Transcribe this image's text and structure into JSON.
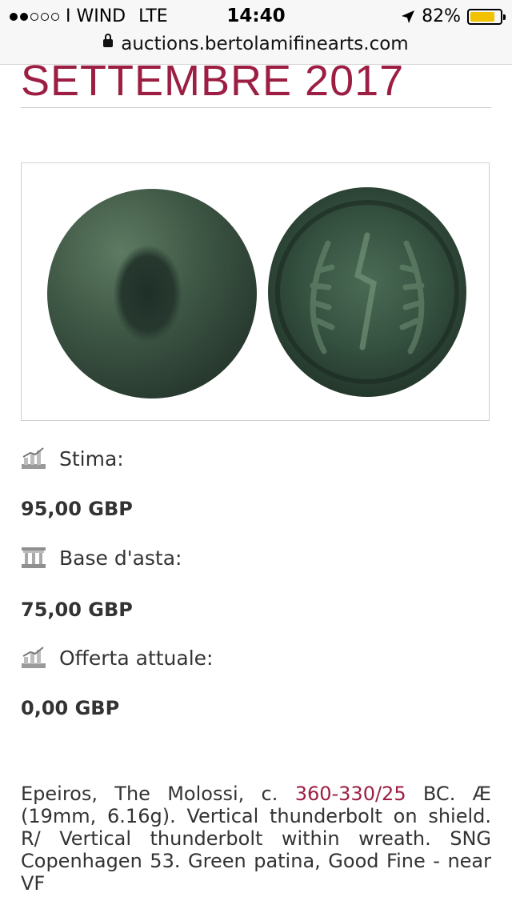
{
  "status_bar": {
    "signal_dots_filled": 2,
    "signal_dots_total": 5,
    "carrier": "I WIND",
    "network": "LTE",
    "time": "14:40",
    "battery_percent": "82%",
    "battery_level": 0.82,
    "battery_color": "#f2c200",
    "url": "auctions.bertolamifinearts.com"
  },
  "page": {
    "title": "SETTEMBRE 2017",
    "title_color": "#9c1f43"
  },
  "lot": {
    "image_alt": "",
    "estimate_label": "Stima:",
    "estimate_value": "95,00 GBP",
    "estimate_icon": "chart-icon",
    "start_label": "Base d'asta:",
    "start_value": "75,00 GBP",
    "start_icon": "bank-icon",
    "current_label": "Offerta attuale:",
    "current_value": "0,00 GBP",
    "current_icon": "chart-icon",
    "description_pre": "Epeiros, The Molossi, c. ",
    "description_link": "360-330/25",
    "description_post": " BC. Æ (19mm, 6.16g). Vertical thunderbolt on shield. R/ Vertical thunderbolt within wreath. SNG Copenhagen 53. Green patina, Good Fine - near VF"
  }
}
